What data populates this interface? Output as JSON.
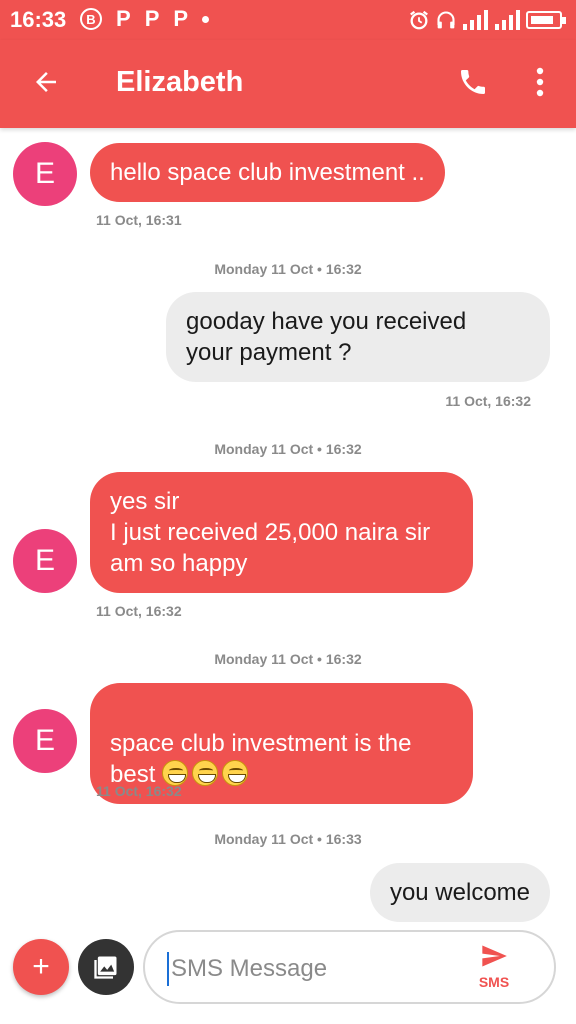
{
  "status_bar": {
    "time": "16:33",
    "left_icons": [
      "b-circle-icon",
      "p-notification-icon",
      "p-notification-icon",
      "p-notification-icon",
      "dot-icon"
    ],
    "p_glyph": "P",
    "b_glyph": "B",
    "right_icons": [
      "alarm-icon",
      "headphones-icon",
      "signal-icon",
      "signal-icon",
      "battery-icon"
    ]
  },
  "app_bar": {
    "title": "Elizabeth",
    "back_icon": "arrow-left-icon",
    "call_icon": "phone-icon",
    "menu_icon": "more-vert-icon"
  },
  "contact": {
    "avatar_letter": "E"
  },
  "messages": [
    {
      "direction": "incoming",
      "text": "hello space club investment ..",
      "timestamp": "11 Oct, 16:31"
    },
    {
      "direction": "separator",
      "text": "Monday 11 Oct • 16:32"
    },
    {
      "direction": "outgoing",
      "text": "gooday have you received\nyour payment ?",
      "timestamp": "11 Oct, 16:32"
    },
    {
      "direction": "separator",
      "text": "Monday 11 Oct • 16:32"
    },
    {
      "direction": "incoming",
      "text": "yes sir\nI just received 25,000 naira sir\nam so happy",
      "timestamp": "11 Oct, 16:32"
    },
    {
      "direction": "separator",
      "text": "Monday 11 Oct • 16:32"
    },
    {
      "direction": "incoming",
      "text": "space club investment is the\nbest ",
      "emoji_count": 3,
      "emoji": "grinning-face-icon",
      "timestamp": "11 Oct, 16:32"
    },
    {
      "direction": "separator",
      "text": "Monday 11 Oct • 16:33"
    },
    {
      "direction": "outgoing",
      "text": "you welcome"
    }
  ],
  "composer": {
    "add_label": "+",
    "placeholder": "SMS Message",
    "value": "",
    "send_label": "SMS",
    "gallery_icon": "gallery-icon",
    "send_icon": "send-icon"
  },
  "colors": {
    "accent": "#f05250",
    "avatar": "#ec407a",
    "outgoing_bubble": "#ececec",
    "meta_text": "#8a8a8a"
  }
}
